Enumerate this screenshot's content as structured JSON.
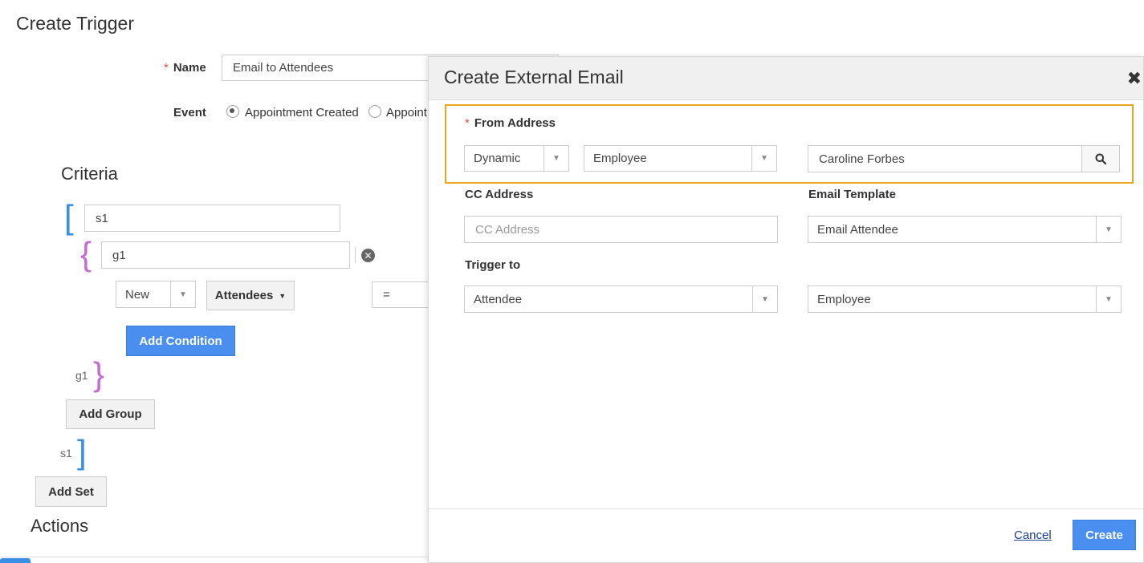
{
  "page": {
    "title": "Create Trigger",
    "name_label": "Name",
    "name_value": "Email to Attendees",
    "event_label": "Event",
    "event_options": [
      "Appointment Created",
      "Appoint"
    ],
    "criteria_title": "Criteria",
    "set_open_value": "s1",
    "group_open_value": "g1",
    "condition": {
      "field1": "New",
      "field2": "Attendees",
      "operator": "="
    },
    "add_condition_label": "Add Condition",
    "group_close_label": "g1",
    "add_group_label": "Add Group",
    "set_close_label": "s1",
    "add_set_label": "Add Set",
    "actions_title": "Actions"
  },
  "modal": {
    "title": "Create External Email",
    "from_address_label": "From Address",
    "from_type": "Dynamic",
    "from_source": "Employee",
    "from_value": "Caroline Forbes",
    "cc_label": "CC Address",
    "cc_placeholder": "CC Address",
    "email_template_label": "Email Template",
    "email_template_value": "Email Attendee",
    "trigger_to_label": "Trigger to",
    "trigger_to_value": "Attendee",
    "trigger_to_secondary": "Employee",
    "cancel_label": "Cancel",
    "create_label": "Create"
  },
  "colors": {
    "primary": "#4a8ef0",
    "highlight": "#e8a520",
    "required": "#d9534f",
    "set_bracket": "#3a8ee6",
    "group_bracket": "#c56bd8"
  }
}
